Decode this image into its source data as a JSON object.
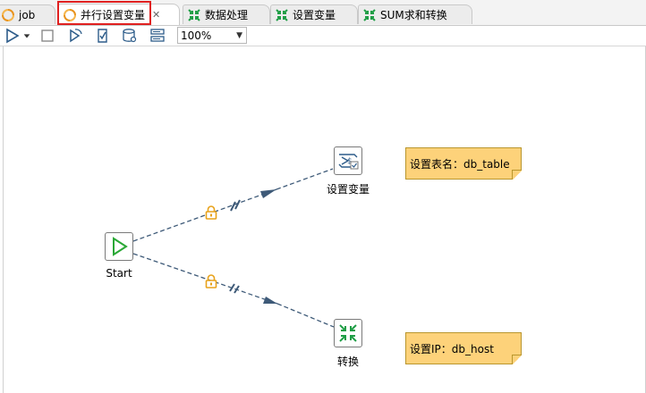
{
  "tabs": [
    {
      "label": "job",
      "icon": "job-icon"
    },
    {
      "label": "并行设置变量",
      "icon": "job-icon",
      "active": true,
      "closable": true
    },
    {
      "label": "数据处理",
      "icon": "transformation-icon"
    },
    {
      "label": "设置变量",
      "icon": "transformation-icon"
    },
    {
      "label": "SUM求和转换",
      "icon": "transformation-icon"
    }
  ],
  "toolbar": {
    "zoom_value": "100%",
    "buttons": [
      "run-icon",
      "run-dropdown-icon",
      "stop-icon",
      "replay-icon",
      "check-icon",
      "sql-icon",
      "explorer-icon"
    ]
  },
  "canvas": {
    "nodes": [
      {
        "label": "Start",
        "icon": "start-icon"
      },
      {
        "label": "设置变量",
        "icon": "set-variables-icon"
      },
      {
        "label": "转换",
        "icon": "transformation-icon"
      }
    ],
    "notes": [
      {
        "text": "设置表名：db_table"
      },
      {
        "text": "设置IP：db_host"
      }
    ],
    "hops": [
      {
        "from": "Start",
        "to": "设置变量",
        "parallel": true
      },
      {
        "from": "Start",
        "to": "转换",
        "parallel": true
      }
    ]
  },
  "colors": {
    "highlight": "#e02020",
    "note": "#fdd27a",
    "hop": "#3e5a78",
    "lock": "#e8a21a",
    "start_green": "#2aa836"
  }
}
